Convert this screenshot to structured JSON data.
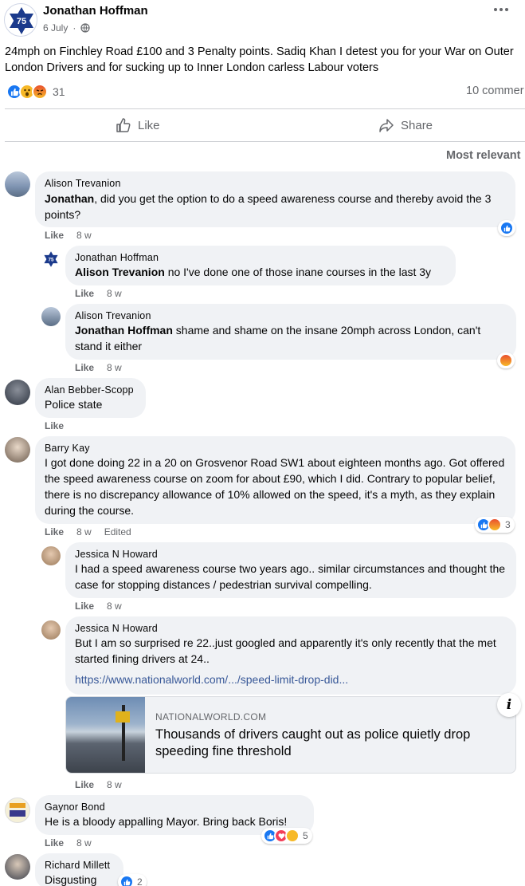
{
  "post": {
    "author": "Jonathan Hoffman",
    "avatar_text": "75",
    "date": "6 July",
    "text": "24mph on Finchley Road £100 and 3 Penalty points. Sadiq Khan I detest you for your War on Outer London Drivers and for sucking up to Inner London carless Labour voters",
    "reaction_count": "31",
    "comments_count": "10 commer",
    "more_icon": "ellipsis-icon"
  },
  "actions": {
    "like": "Like",
    "share": "Share"
  },
  "sort_label": "Most relevant",
  "comments": [
    {
      "name": "Alison Trevanion",
      "tag": "Jonathan",
      "text": ", did you get the option to do a speed awareness course and thereby avoid the 3 points?",
      "like": "Like",
      "time": "8 w"
    },
    {
      "name": "Jonathan Hoffman",
      "avatar_text": "75",
      "tag": "Alison Trevanion",
      "text": " no I've done one of those inane courses in the last 3y",
      "like": "Like",
      "time": "8 w"
    },
    {
      "name": "Alison Trevanion",
      "tag": "Jonathan Hoffman",
      "text": " shame and shame on the insane 20mph across London, can't stand it either",
      "like": "Like",
      "time": "8 w"
    },
    {
      "name": "Alan Bebber-Scopp",
      "text": "Police state",
      "like": "Like"
    },
    {
      "name": "Barry Kay",
      "text": "I got done doing 22 in a 20 on Grosvenor Road SW1 about eighteen months ago. Got offered the speed awareness course on zoom for about £90, which I did. Contrary to popular belief, there is no discrepancy allowance of 10% allowed on the speed, it's a myth, as they explain during the course.",
      "like": "Like",
      "time": "8 w",
      "edited": "Edited",
      "reaction_count": "3"
    },
    {
      "name": "Jessica N Howard",
      "text": "I had a speed awareness course two years ago.. similar circumstances and thought the case for stopping distances / pedestrian survival compelling.",
      "like": "Like",
      "time": "8 w"
    },
    {
      "name": "Jessica N Howard",
      "text": "But I am so surprised re 22..just googled and apparently it's only recently that the met started fining drivers at 24..",
      "link": "https://www.nationalworld.com/.../speed-limit-drop-did...",
      "like": "Like",
      "time": "8 w"
    },
    {
      "name": "Gaynor Bond",
      "text": "He is a bloody appalling Mayor. Bring back Boris!",
      "like": "Like",
      "time": "8 w",
      "reaction_count": "5"
    },
    {
      "name": "Richard Millett",
      "text": "Disgusting",
      "reaction_count": "2"
    }
  ],
  "link_preview": {
    "domain": "NATIONALWORLD.COM",
    "title": "Thousands of drivers caught out as police quietly drop speeding fine threshold",
    "info_icon": "info-icon"
  },
  "colors": {
    "facebook_blue": "#1877f2",
    "bubble_gray": "#f0f2f5",
    "meta_gray": "#65676b",
    "link": "#385898",
    "avatar_navy": "#1b3a8c"
  }
}
